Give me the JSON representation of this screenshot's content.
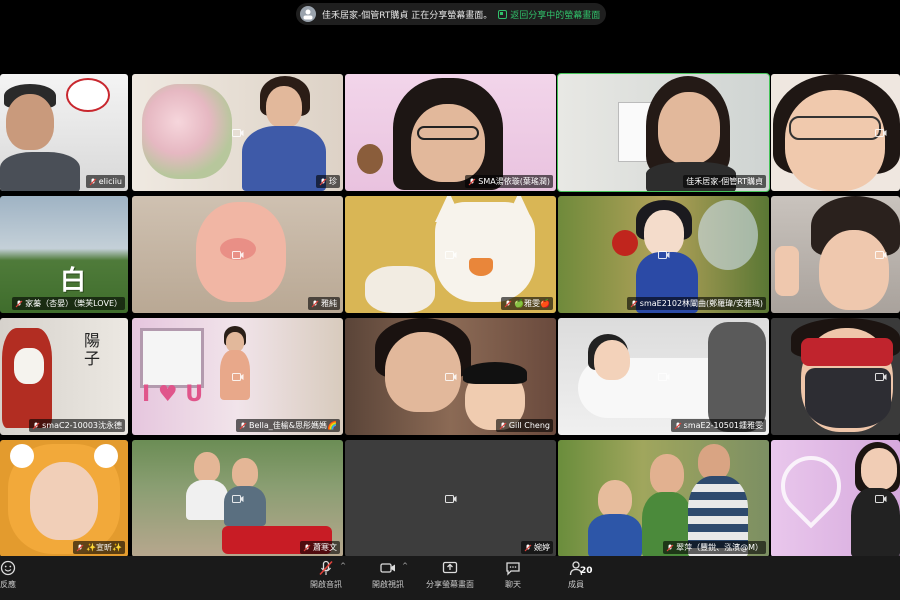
{
  "banner": {
    "share_text": "佳禾居家-個管RT購貞 正在分享螢幕畫面。",
    "return_label": "返回分享中的螢幕畫面"
  },
  "participants": [
    {
      "name": "eliciiu"
    },
    {
      "name": "珍"
    },
    {
      "name": "SMA湯依璇(葉瑤潤)"
    },
    {
      "name": "佳禾居家-個管RT購貞"
    },
    {
      "name": ""
    },
    {
      "name": "家蓁（杏晏）（樂芙LOVE）"
    },
    {
      "name": "雅純"
    },
    {
      "name": "🍏雅雯🍎"
    },
    {
      "name": "smaE2102林闡曲(鄭羅瑋/安雅瑪)"
    },
    {
      "name": ""
    },
    {
      "name": "smaC2-10003沈永德"
    },
    {
      "name": "Bella_佳榆&思彤媽媽🌈"
    },
    {
      "name": "Gill Cheng"
    },
    {
      "name": "smaE2-10501鍾雅雯"
    },
    {
      "name": ""
    },
    {
      "name": "✨宣昕✨"
    },
    {
      "name": "蕭寒文"
    },
    {
      "name": "婉婷"
    },
    {
      "name": "翠萍（豐銳、泓濱@M）"
    },
    {
      "name": ""
    }
  ],
  "toolbar": {
    "reactions_label": "反應",
    "unmute_label": "開啟音訊",
    "video_label": "開啟視訊",
    "share_label": "分享螢幕畫面",
    "chat_label": "聊天",
    "participants_label": "成員",
    "participants_count": "20"
  },
  "colors": {
    "active_speaker": "#46c45a",
    "muted_red": "#e0413a",
    "return_green": "#30c06a"
  }
}
